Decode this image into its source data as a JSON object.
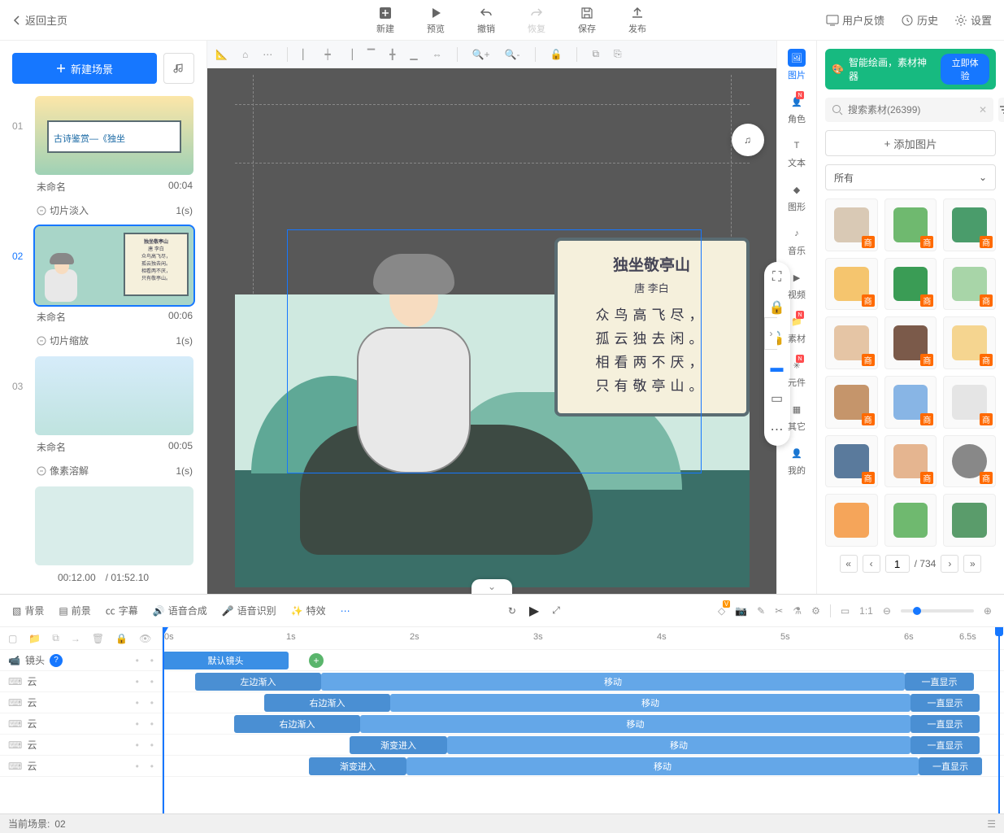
{
  "header": {
    "back": "返回主页",
    "tools": {
      "new": "新建",
      "preview": "预览",
      "undo": "撤销",
      "redo": "恢复",
      "save": "保存",
      "publish": "发布"
    },
    "right": {
      "feedback": "用户反馈",
      "history": "历史",
      "settings": "设置"
    }
  },
  "scenes": {
    "new_scene": "新建场景",
    "items": [
      {
        "num": "01",
        "name": "未命名",
        "dur": "00:04",
        "trans": "切片淡入",
        "trans_dur": "1(s)",
        "thumb_title": "古诗鉴赏—《独坐"
      },
      {
        "num": "02",
        "name": "未命名",
        "dur": "00:06",
        "trans": "切片缩放",
        "trans_dur": "1(s)",
        "selected": true
      },
      {
        "num": "03",
        "name": "未命名",
        "dur": "00:05",
        "trans": "像素溶解",
        "trans_dur": "1(s)"
      }
    ],
    "cur_time": "00:12.00",
    "total_time": "/ 01:52.10"
  },
  "poem": {
    "title": "独坐敬亭山",
    "author": "唐 李白",
    "l1": "众鸟高飞尽，",
    "l2": "孤云独去闲。",
    "l3": "相看两不厌，",
    "l4": "只有敬亭山。"
  },
  "categories": {
    "image": "图片",
    "role": "角色",
    "text": "文本",
    "shape": "图形",
    "music": "音乐",
    "video": "视频",
    "asset": "素材",
    "component": "元件",
    "other": "其它",
    "mine": "我的"
  },
  "right_panel": {
    "ai_text": "智能绘画，素材神器",
    "ai_btn": "立即体验",
    "search_placeholder": "搜索素材(26399)",
    "add_image": "添加图片",
    "cat_all": "所有",
    "asset_tag": "商",
    "page": "1",
    "pages": "/ 734"
  },
  "timeline": {
    "tabs": {
      "bg": "背景",
      "fg": "前景",
      "subtitle": "字幕",
      "tts": "语音合成",
      "asr": "语音识别",
      "fx": "特效"
    },
    "camera": "镜头",
    "default_cam": "默认镜头",
    "cloud": "云",
    "enter_left": "左边渐入",
    "enter_right": "右边渐入",
    "fade_in": "渐变进入",
    "move": "移动",
    "always": "一直显示",
    "ruler": [
      "0s",
      "1s",
      "2s",
      "3s",
      "4s",
      "5s",
      "6s",
      "6.5s"
    ]
  },
  "footer": {
    "label": "当前场景:",
    "value": "02"
  }
}
